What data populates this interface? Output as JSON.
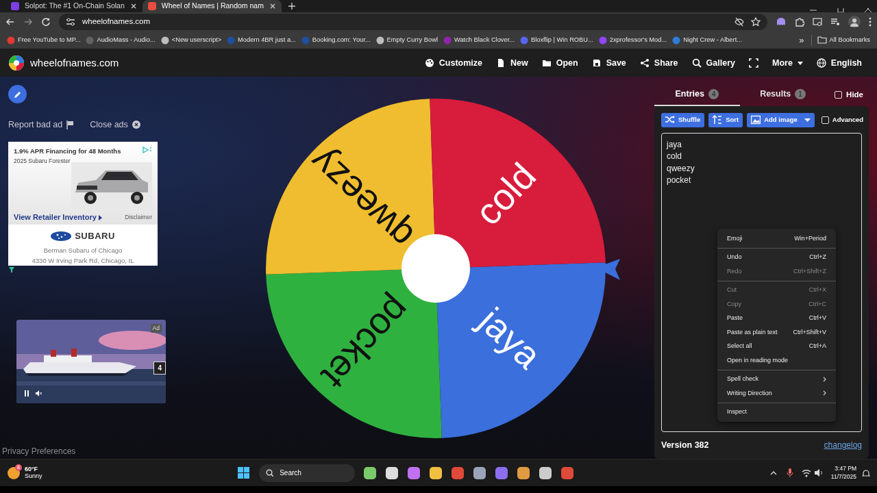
{
  "browser": {
    "tabs": [
      {
        "title": "Solpot: The #1 On-Chain Solan",
        "selected": false
      },
      {
        "title": "Wheel of Names | Random nam",
        "selected": true
      }
    ],
    "address": "wheelofnames.com",
    "bookmarks": [
      {
        "label": "Free YouTube to MP...",
        "color": "#e53935"
      },
      {
        "label": "AudioMass - Audio...",
        "color": "#5f6368"
      },
      {
        "label": "<New userscript>",
        "color": "#bdbdbd"
      },
      {
        "label": "Modern 4BR just a...",
        "color": "#1e4fa0"
      },
      {
        "label": "Booking.com: Your...",
        "color": "#1e4fa0"
      },
      {
        "label": "Empty Curry Bowl",
        "color": "#bdbdbd"
      },
      {
        "label": "Watch Black Clover...",
        "color": "#8e24aa"
      },
      {
        "label": "Bloxflip | Win ROBU...",
        "color": "#5865f2"
      },
      {
        "label": "2xprofessor's Mod...",
        "color": "#9146ff"
      },
      {
        "label": "Night Crew - Albert...",
        "color": "#2e7dd7"
      }
    ],
    "more_bookmarks": "»",
    "all_bookmarks": "All Bookmarks"
  },
  "app": {
    "logo": "wheelofnames.com",
    "menu": [
      {
        "kind": "text",
        "label": "Customize"
      },
      {
        "kind": "text",
        "label": "New"
      },
      {
        "kind": "text",
        "label": "Open"
      },
      {
        "kind": "text",
        "label": "Save"
      },
      {
        "kind": "text",
        "label": "Share"
      },
      {
        "kind": "text",
        "label": "Gallery"
      },
      {
        "kind": "icon"
      },
      {
        "kind": "dropdown",
        "label": "More"
      },
      {
        "kind": "text",
        "label": "English"
      }
    ]
  },
  "ads": {
    "report": "Report bad ad",
    "close": "Close ads",
    "banner": {
      "headline": "1.9% APR Financing for 48 Months",
      "subline": "2025 Subaru Forester",
      "cta": "View Retailer Inventory",
      "disclaimer": "Disclaimer",
      "brand": "SUBARU",
      "dealer": "Berman Subaru of Chicago",
      "address": "4330 W Irving Park Rd, Chicago, IL"
    },
    "video": {
      "badge": "Ad",
      "countdown": "4"
    }
  },
  "privacy": "Privacy Preferences",
  "wheel": {
    "slices": [
      {
        "label": "jaya",
        "color": "#3a6fdc"
      },
      {
        "label": "pocket",
        "color": "#2fb140"
      },
      {
        "label": "qweezy",
        "color": "#efbd2f"
      },
      {
        "label": "cold",
        "color": "#d81c3c"
      }
    ]
  },
  "panel": {
    "tabs": [
      {
        "label": "Entries",
        "count": "4",
        "selected": true
      },
      {
        "label": "Results",
        "count": "1",
        "selected": false
      }
    ],
    "hide": {
      "label": "Hide",
      "checked": false
    },
    "buttons": [
      "Shuffle",
      "Sort",
      "Add image"
    ],
    "advanced": {
      "label": "Advanced",
      "checked": false
    },
    "entries": [
      "jaya",
      "cold",
      "qweezy",
      "pocket"
    ],
    "version": "Version 382",
    "changelog": "changelog"
  },
  "context_menu": {
    "groups": [
      [
        {
          "label": "Emoji",
          "shortcut": "Win+Period",
          "disabled": false
        }
      ],
      [
        {
          "label": "Undo",
          "shortcut": "Ctrl+Z",
          "disabled": false
        },
        {
          "label": "Redo",
          "shortcut": "Ctrl+Shift+Z",
          "disabled": true
        }
      ],
      [
        {
          "label": "Cut",
          "shortcut": "Ctrl+X",
          "disabled": true
        },
        {
          "label": "Copy",
          "shortcut": "Ctrl+C",
          "disabled": true
        },
        {
          "label": "Paste",
          "shortcut": "Ctrl+V",
          "disabled": false
        },
        {
          "label": "Paste as plain text",
          "shortcut": "Ctrl+Shift+V",
          "disabled": false
        },
        {
          "label": "Select all",
          "shortcut": "Ctrl+A",
          "disabled": false
        },
        {
          "label": "Open in reading mode",
          "disabled": false
        }
      ],
      [
        {
          "label": "Spell check",
          "submenu": true,
          "disabled": false
        },
        {
          "label": "Writing Direction",
          "submenu": true,
          "disabled": false
        }
      ],
      [
        {
          "label": "Inspect",
          "disabled": false
        }
      ]
    ]
  },
  "taskbar": {
    "weather": {
      "temp": "60°F",
      "condition": "Sunny",
      "badge": "8"
    },
    "search": "Search",
    "time": "3:47 PM",
    "date": "11/7/2025"
  }
}
